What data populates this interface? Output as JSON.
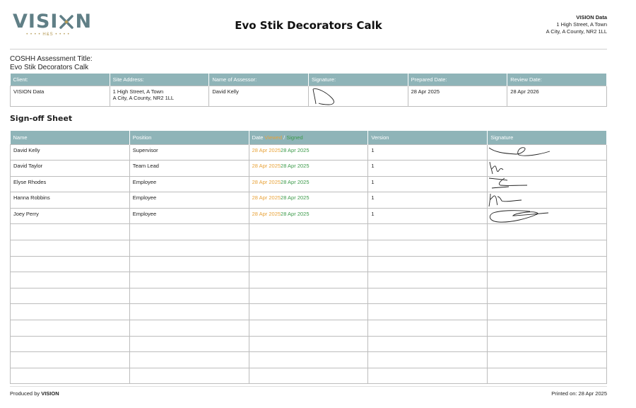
{
  "header": {
    "logo_text_left": "VISI",
    "logo_text_right": "N",
    "logo_sub": "• • • • H&S • • • •",
    "title": "Evo Stik Decorators Calk",
    "company": {
      "name": "VISION Data",
      "address1": "1 High Street, A Town",
      "address2": "A City, A County, NR2 1LL"
    }
  },
  "assessment": {
    "label": "COSHH Assessment Title:",
    "value": "Evo Stik Decorators Calk"
  },
  "info_table": {
    "headers": [
      "Client:",
      "Site Address:",
      "Name of Assessor:",
      "Signature:",
      "Prepared Date:",
      "Review Date:"
    ],
    "client": "VISION Data",
    "site_address1": "1 High Street, A Town",
    "site_address2": "A City, A County, NR2 1LL",
    "assessor": "David Kelly",
    "prepared_date": "28 Apr 2025",
    "review_date": "28 Apr 2026"
  },
  "signoff": {
    "title": "Sign-off Sheet",
    "headers": {
      "name": "Name",
      "position": "Position",
      "date": "Date",
      "viewed": "Viewed",
      "slash": " / ",
      "signed": "Signed",
      "version": "Version",
      "signature": "Signature"
    },
    "rows": [
      {
        "name": "David Kelly",
        "position": "Supervisor",
        "viewed": "28 Apr 2025",
        "signed": "28 Apr 2025",
        "version": "1"
      },
      {
        "name": "David Taylor",
        "position": "Team Lead",
        "viewed": "28 Apr 2025",
        "signed": "28 Apr 2025",
        "version": "1"
      },
      {
        "name": "Elyse Rhodes",
        "position": "Employee",
        "viewed": "28 Apr 2025",
        "signed": "28 Apr 2025",
        "version": "1"
      },
      {
        "name": "Hanna Robbins",
        "position": "Employee",
        "viewed": "28 Apr 2025",
        "signed": "28 Apr 2025",
        "version": "1"
      },
      {
        "name": "Joey Perry",
        "position": "Employee",
        "viewed": "28 Apr 2025",
        "signed": "28 Apr 2025",
        "version": "1"
      }
    ],
    "empty_rows": 10
  },
  "footer": {
    "produced_by": "Produced by ",
    "produced_brand": "VISION",
    "printed": "Printed on: 28 Apr 2025"
  },
  "colors": {
    "header_bg": "#8fb4b8",
    "viewed": "#e8a33a",
    "signed": "#3c9a4a",
    "logo": "#607f86"
  }
}
